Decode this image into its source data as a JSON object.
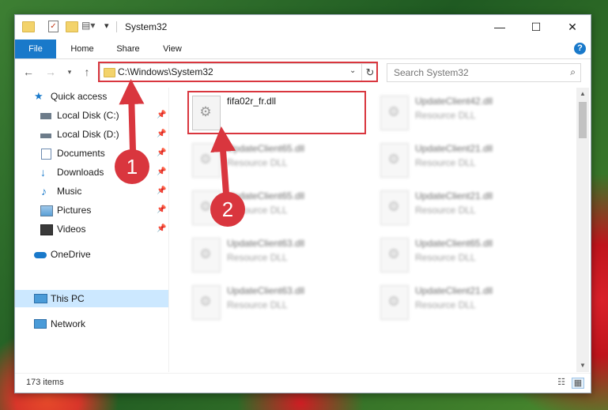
{
  "window": {
    "title": "System32",
    "controls": {
      "minimize": "—",
      "maximize": "☐",
      "close": "✕"
    }
  },
  "ribbon": {
    "tabs": [
      "File",
      "Home",
      "Share",
      "View"
    ],
    "help": "?"
  },
  "address": {
    "path": "C:\\Windows\\System32",
    "search_placeholder": "Search System32"
  },
  "nav": {
    "items": [
      {
        "label": "Quick access",
        "icon": "star-icon",
        "pinned": false
      },
      {
        "label": "Local Disk (C:)",
        "icon": "drive-icon",
        "pinned": true
      },
      {
        "label": "Local Disk (D:)",
        "icon": "drive-icon",
        "pinned": true
      },
      {
        "label": "Documents",
        "icon": "documents-icon",
        "pinned": true
      },
      {
        "label": "Downloads",
        "icon": "downloads-icon",
        "pinned": true
      },
      {
        "label": "Music",
        "icon": "music-icon",
        "pinned": true
      },
      {
        "label": "Pictures",
        "icon": "pictures-icon",
        "pinned": true
      },
      {
        "label": "Videos",
        "icon": "videos-icon",
        "pinned": true
      },
      {
        "label": "OneDrive",
        "icon": "onedrive-icon",
        "pinned": false
      },
      {
        "label": "This PC",
        "icon": "pc-icon",
        "pinned": false,
        "selected": true
      },
      {
        "label": "Network",
        "icon": "network-icon",
        "pinned": false
      }
    ]
  },
  "files": {
    "left": [
      {
        "name": "fifa02r_fr.dll",
        "desc": ""
      },
      {
        "name": "UpdateClient65.dll",
        "desc": "Resource DLL"
      },
      {
        "name": "UpdateClient65.dll",
        "desc": "Resource DLL"
      },
      {
        "name": "UpdateClient63.dll",
        "desc": "Resource DLL"
      },
      {
        "name": "UpdateClient63.dll",
        "desc": "Resource DLL"
      }
    ],
    "right": [
      {
        "name": "UpdateClient42.dll",
        "desc": "Resource DLL"
      },
      {
        "name": "UpdateClient21.dll",
        "desc": "Resource DLL"
      },
      {
        "name": "UpdateClient21.dll",
        "desc": "Resource DLL"
      },
      {
        "name": "UpdateClient65.dll",
        "desc": "Resource DLL"
      },
      {
        "name": "UpdateClient21.dll",
        "desc": "Resource DLL"
      }
    ]
  },
  "status": {
    "count": "173 items"
  },
  "annotations": {
    "step1": "1",
    "step2": "2"
  },
  "colors": {
    "accent": "#1979ca",
    "highlight": "#d9363e",
    "selection": "#cce8ff"
  }
}
